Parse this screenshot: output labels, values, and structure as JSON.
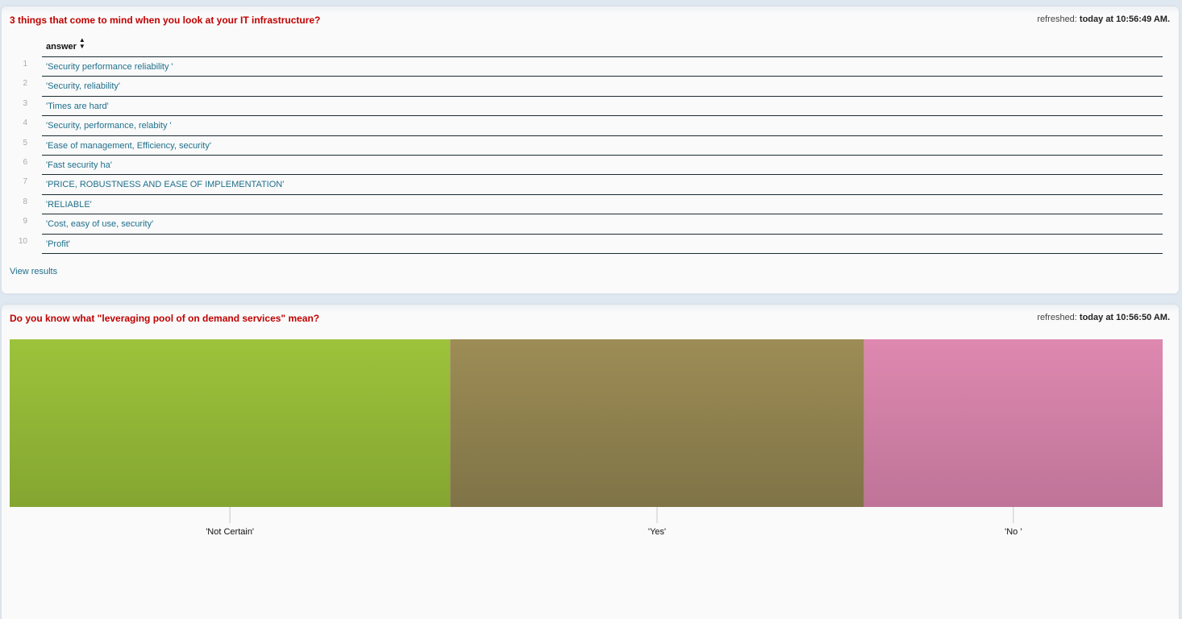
{
  "panel1": {
    "title": "3 things that come to mind when you look at your IT infrastructure?",
    "refreshed_label": "refreshed:",
    "refreshed_value": "today at 10:56:49 AM.",
    "column_header": "answer",
    "sort_icon": "sort-icon",
    "rows": [
      {
        "num": "1",
        "answer": "'Security performance reliability '"
      },
      {
        "num": "2",
        "answer": "'Security, reliability'"
      },
      {
        "num": "3",
        "answer": "'Times are hard'"
      },
      {
        "num": "4",
        "answer": "'Security, performance, relabity '"
      },
      {
        "num": "5",
        "answer": "'Ease of management, Efficiency, security'"
      },
      {
        "num": "6",
        "answer": "'Fast security ha'"
      },
      {
        "num": "7",
        "answer": "'PRICE, ROBUSTNESS AND EASE OF IMPLEMENTATION'"
      },
      {
        "num": "8",
        "answer": "'RELIABLE'"
      },
      {
        "num": "9",
        "answer": "'Cost, easy of use, security'"
      },
      {
        "num": "10",
        "answer": "'Profit'"
      }
    ],
    "view_results": "View results"
  },
  "panel2": {
    "title": "Do you know what \"leveraging pool of on demand services\" mean?",
    "refreshed_label": "refreshed:",
    "refreshed_value": "today at 10:56:50 AM."
  },
  "colors": {
    "title": "#c00000",
    "link": "#1f6f8b"
  },
  "chart_data": {
    "type": "bar",
    "subtype": "stacked-100-horizontal",
    "categories": [
      "'Not Certain'",
      "'Yes'",
      "'No '"
    ],
    "values": [
      38.2,
      35.9,
      25.9
    ],
    "colors": [
      {
        "top": "#9cc33b",
        "bottom": "#84a631"
      },
      {
        "top": "#9d8c55",
        "bottom": "#7f7447"
      },
      {
        "top": "#de88b0",
        "bottom": "#bf7498"
      }
    ],
    "grid": false,
    "legend": "none"
  }
}
